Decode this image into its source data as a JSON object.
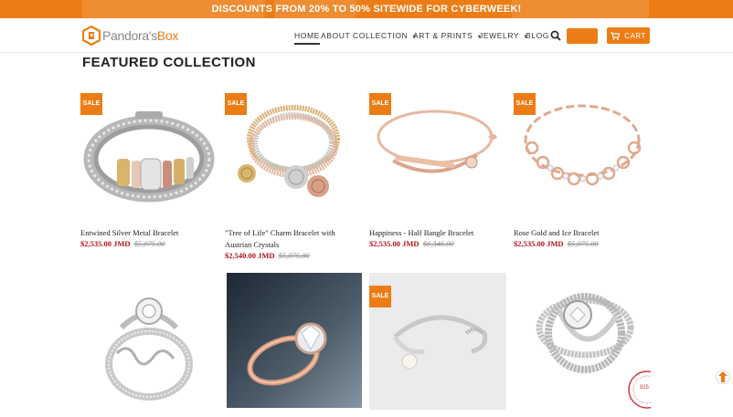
{
  "announcement": "DISCOUNTS FROM 20% TO 50% SITEWIDE FOR CYBERWEEK!",
  "brand": {
    "name_part1": "Pandora's",
    "name_part2": "Box",
    "accent": "#ec7d16"
  },
  "nav": {
    "home": "HOME",
    "about": "ABOUT",
    "collection": "COLLECTION",
    "art_prints": "ART & PRINTS",
    "jewelry": "JEWELRY",
    "blog": "BLOG",
    "cart": "CART"
  },
  "icons": [
    "search-icon",
    "cart-icon",
    "chevron-down-icon",
    "arrow-up-icon"
  ],
  "section_title": "FEATURED COLLECTION",
  "sale_badge": "SALE",
  "products": [
    {
      "name": "Entwined Silver Metal Bracelet",
      "price": "$2,535.00 JMD",
      "was": "$5,075.00",
      "sale": true
    },
    {
      "name": "\"Tree of Life\" Charm Bracelet with Austrian Crystals",
      "price": "$2,540.00 JMD",
      "was": "$5,075.00",
      "sale": true
    },
    {
      "name": "Happiness - Half Bangle Bracelet",
      "price": "$2,535.00 JMD",
      "was": "$6,346.00",
      "sale": true
    },
    {
      "name": "Rose Gold and Ice Bracelet",
      "price": "$2,535.00 JMD",
      "was": "$5,075.00",
      "sale": true
    },
    {
      "name": "",
      "price": "",
      "was": "",
      "sale": false
    },
    {
      "name": "",
      "price": "",
      "was": "",
      "sale": false
    },
    {
      "name": "",
      "price": "",
      "was": "",
      "sale": true
    },
    {
      "name": "",
      "price": "",
      "was": "",
      "sale": false
    }
  ],
  "seal_text": "925"
}
